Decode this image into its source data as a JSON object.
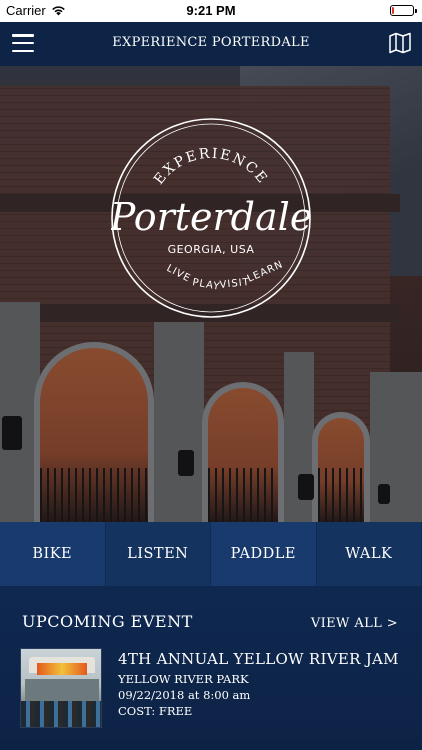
{
  "status_bar": {
    "carrier": "Carrier",
    "time": "9:21 PM"
  },
  "header": {
    "title": "EXPERIENCE PORTERDALE",
    "menu_icon": "hamburger-menu-icon",
    "map_icon": "map-icon"
  },
  "logo": {
    "top_text": "EXPERIENCE",
    "script_text": "Porterdale",
    "location": "GEORGIA, USA",
    "bottom_words": [
      "LIVE",
      "PLAY",
      "VISIT",
      "LEARN"
    ]
  },
  "activities": [
    {
      "label": "BIKE"
    },
    {
      "label": "LISTEN"
    },
    {
      "label": "PADDLE"
    },
    {
      "label": "WALK"
    }
  ],
  "events": {
    "heading": "UPCOMING EVENT",
    "view_all": "VIEW ALL >",
    "items": [
      {
        "title": "4TH ANNUAL YELLOW RIVER JAM",
        "venue": "YELLOW RIVER PARK",
        "datetime": "09/22/2018 at 8:00 am",
        "cost": "COST: FREE"
      }
    ]
  },
  "colors": {
    "navy": "#0e2447",
    "activity_bar": "#153463",
    "battery_low": "#e0312c"
  }
}
